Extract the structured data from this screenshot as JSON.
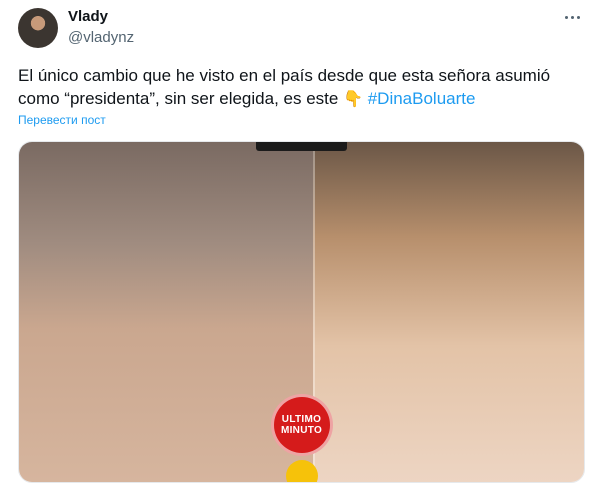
{
  "tweet": {
    "author_name": "Vlady",
    "author_handle": "@vladynz",
    "text_prefix": "El único cambio que he visto en el país desde que esta señora asumió como “presidenta”, sin ser elegida, es este ",
    "emoji": "👇",
    "hashtag": "#DinaBoluarte",
    "translate_label": "Перевести пост",
    "more_icon": "more-horizontal-icon"
  },
  "media": {
    "badge_text": "ULTIMO MINUTO",
    "badge_color": "#d51b1b",
    "accent_dot_color": "#f6c20a"
  },
  "colors": {
    "link": "#1d9bf0",
    "secondary_text": "#536471"
  }
}
